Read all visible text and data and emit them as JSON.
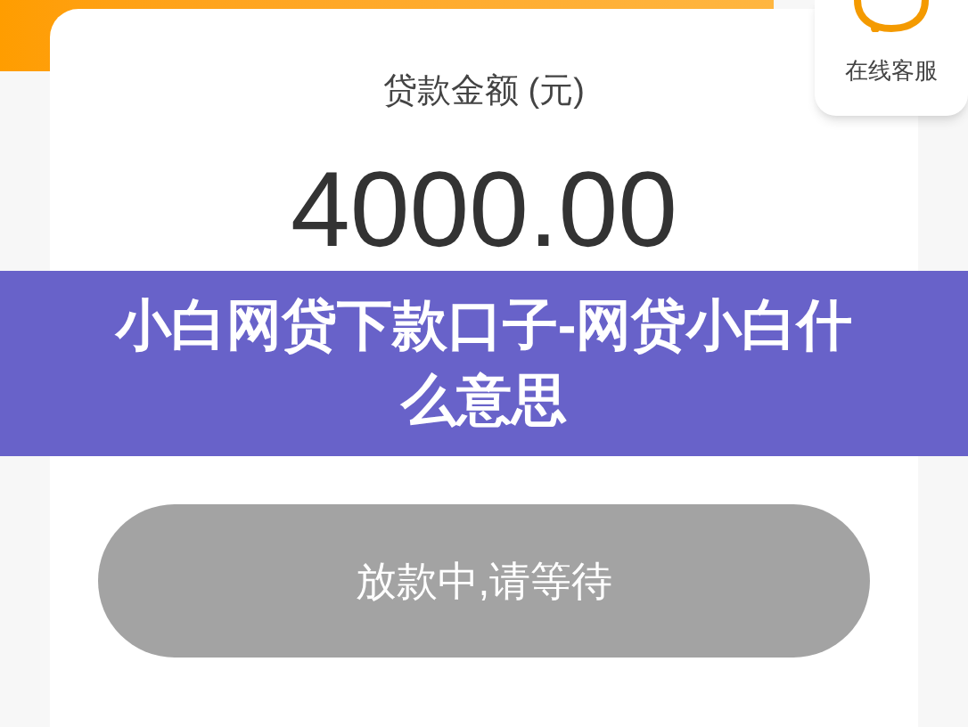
{
  "customer_service": {
    "label": "在线客服"
  },
  "loan_card": {
    "label": "贷款金额 (元)",
    "amount": "4000.00"
  },
  "overlay_title": {
    "text": "小白网贷下款口子-网贷小白什么意思"
  },
  "status_button": {
    "label": "放款中,请等待",
    "disabled": true
  }
}
